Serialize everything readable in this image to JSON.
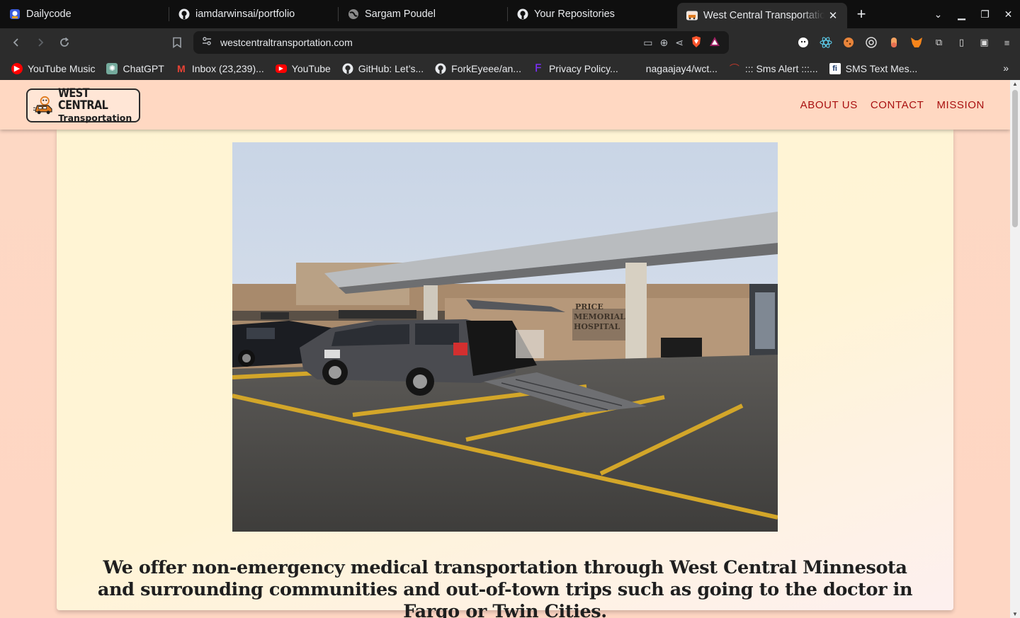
{
  "browser": {
    "tabs": [
      {
        "title": "Dailycode",
        "icon": "dailycode-icon"
      },
      {
        "title": "iamdarwinsai/portfolio",
        "icon": "github-icon"
      },
      {
        "title": "Sargam Poudel",
        "icon": "globe-icon"
      },
      {
        "title": "Your Repositories",
        "icon": "github-icon"
      },
      {
        "title": "West Central Transportation",
        "icon": "site-icon",
        "active": true
      }
    ],
    "url": "westcentraltransportation.com",
    "bookmarks": [
      {
        "label": "YouTube Music",
        "icon": "youtube-music-icon",
        "color": "#ff0000"
      },
      {
        "label": "ChatGPT",
        "icon": "chatgpt-icon",
        "color": "#74aa9c"
      },
      {
        "label": "Inbox (23,239)...",
        "icon": "gmail-icon",
        "color": "#ea4335"
      },
      {
        "label": "YouTube",
        "icon": "youtube-icon",
        "color": "#ff0000"
      },
      {
        "label": "GitHub: Let’s...",
        "icon": "github-icon",
        "color": "#ffffff"
      },
      {
        "label": "ForkEyeee/an...",
        "icon": "github-icon",
        "color": "#ffffff"
      },
      {
        "label": "Privacy Policy...",
        "icon": "policy-icon",
        "color": "#7b2ff7"
      },
      {
        "label": "nagaajay4/wct...",
        "icon": "github-icon",
        "color": "#2c2c2c"
      },
      {
        "label": "::: Sms Alert :::...",
        "icon": "sms-alert-icon",
        "color": "#c0392b"
      },
      {
        "label": "SMS Text Mes...",
        "icon": "sms-icon",
        "color": "#ffffff"
      }
    ]
  },
  "site": {
    "logo_line1": "WEST CENTRAL",
    "logo_line2": "Transportation",
    "nav": [
      "ABOUT US",
      "CONTACT",
      "MISSION"
    ],
    "hero_photo_sign": "PRICE MEMORIAL HOSPITAL",
    "tagline": "We offer non-emergency medical transportation through West Central Minnesota and surrounding communities and out-of-town trips such as going to the doctor in Fargo or Twin Cities.",
    "colors": {
      "header_bg": "#ffd8c2",
      "nav_text": "#a80f0f",
      "card_bg": "#fff4d3",
      "page_bg": "#fdd8c4"
    }
  }
}
